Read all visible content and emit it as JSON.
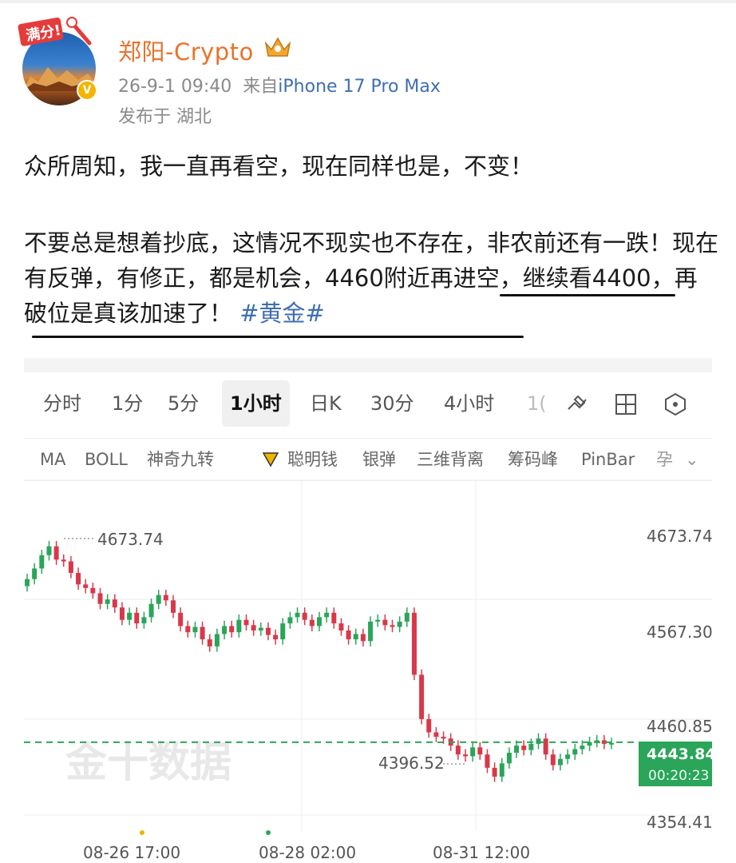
{
  "post": {
    "username": "郑阳-Crypto",
    "avatar_badge": "满分!",
    "verified_mark": "V",
    "time": "26-9-1 09:40",
    "source_prefix": "来自",
    "device": "iPhone 17 Pro Max",
    "location": "发布于 湖北",
    "para1": "众所周知，我一直再看空，现在同样也是，不变！",
    "para2": "不要总是想着抄底，这情况不现实也不存在，非农前还有一跌！现在有反弹，有修正，都是机会，4460附近再进空，继续看4400，再破位是真该加速了！",
    "hashtag": "#黄金#"
  },
  "chart_tabs": [
    "分时",
    "1分",
    "5分",
    "1小时",
    "日K",
    "30分",
    "4小时",
    "1("
  ],
  "chart_tabs_active": "1小时",
  "tools": [
    "draw-line-icon",
    "layout-grid-icon",
    "settings-hexagon-icon"
  ],
  "indicators": [
    "MA",
    "BOLL",
    "神奇九转",
    "聪明钱",
    "银弹",
    "三维背离",
    "筹码峰",
    "PinBar",
    "孕"
  ],
  "chart_data": {
    "type": "candlestick",
    "price_labels": [
      "4673.74",
      "4567.30",
      "4460.85",
      "4354.41"
    ],
    "current_price": "4443.84",
    "countdown": "00:20:23",
    "high_marker": "4673.74",
    "low_marker": "4396.52",
    "x_labels": [
      "08-26 17:00",
      "08-28 02:00",
      "08-31 12:00"
    ],
    "watermark": "金十数据",
    "up_color": "#2aa55a",
    "down_color": "#d8384a",
    "ohlc_close_path": [
      4628,
      4640,
      4655,
      4665,
      4650,
      4648,
      4635,
      4622,
      4618,
      4612,
      4600,
      4605,
      4596,
      4582,
      4590,
      4578,
      4585,
      4600,
      4610,
      4604,
      4590,
      4575,
      4568,
      4574,
      4560,
      4552,
      4566,
      4575,
      4568,
      4582,
      4576,
      4570,
      4573,
      4565,
      4560,
      4578,
      4585,
      4590,
      4582,
      4575,
      4585,
      4590,
      4578,
      4570,
      4560,
      4566,
      4558,
      4580,
      4582,
      4576,
      4574,
      4580,
      4590,
      4520,
      4470,
      4455,
      4450,
      4448,
      4440,
      4430,
      4428,
      4438,
      4430,
      4415,
      4405,
      4420,
      4432,
      4440,
      4435,
      4442,
      4448,
      4430,
      4418,
      4425,
      4430,
      4436,
      4440,
      4444,
      4446,
      4442,
      4443
    ]
  }
}
